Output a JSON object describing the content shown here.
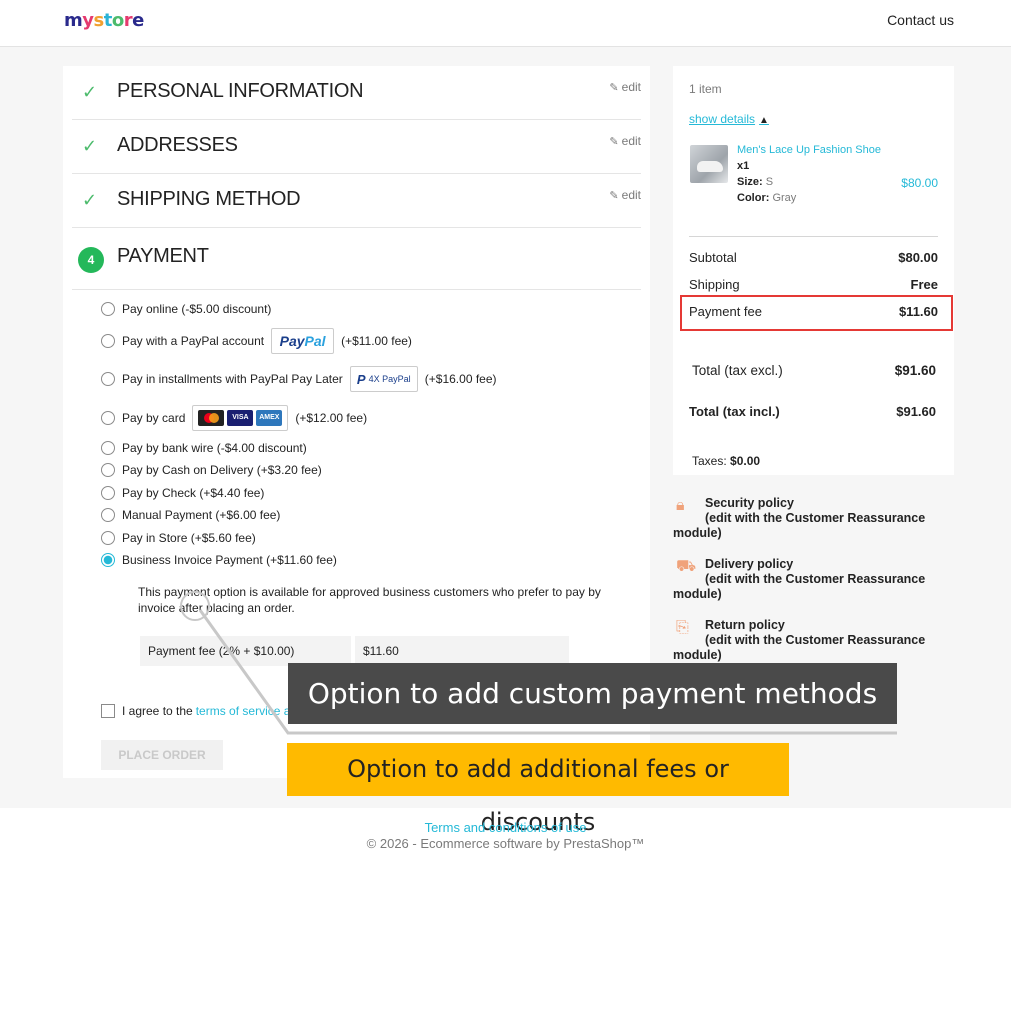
{
  "header": {
    "logo": {
      "parts": [
        "m",
        "y",
        " ",
        "s",
        "t",
        "o",
        "r",
        "e"
      ]
    },
    "contact": "Contact us"
  },
  "steps": [
    {
      "title": "PERSONAL INFORMATION",
      "edit": "edit",
      "status": "complete"
    },
    {
      "title": "ADDRESSES",
      "edit": "edit",
      "status": "complete"
    },
    {
      "title": "SHIPPING METHOD",
      "edit": "edit",
      "status": "complete"
    },
    {
      "title": "PAYMENT",
      "number": "4",
      "status": "current"
    }
  ],
  "payment": {
    "options": [
      {
        "label": "Pay online (-$5.00 discount)",
        "selected": false
      },
      {
        "label": "Pay with a PayPal account",
        "suffix": "(+$11.00 fee)",
        "logo": "paypal-logo",
        "selected": false
      },
      {
        "label": "Pay in installments with PayPal Pay Later",
        "suffix": "(+$16.00 fee)",
        "logo": "paypal-4x-logo",
        "logo_text": "4X PayPal",
        "selected": false
      },
      {
        "label": "Pay by card",
        "suffix": "(+$12.00 fee)",
        "logo": "card-logos",
        "selected": false
      },
      {
        "label": "Pay by bank wire (-$4.00 discount)",
        "selected": false
      },
      {
        "label": "Pay by Cash on Delivery (+$3.20 fee)",
        "selected": false
      },
      {
        "label": "Pay by Check (+$4.40 fee)",
        "selected": false
      },
      {
        "label": "Manual Payment (+$6.00 fee)",
        "selected": false
      },
      {
        "label": "Pay in Store (+$5.60 fee)",
        "selected": false
      },
      {
        "label": "Business Invoice Payment (+$11.60 fee)",
        "selected": true
      }
    ],
    "paypal_logo": {
      "p1": "Pay",
      "p2": "Pal"
    },
    "card_logos": [
      "",
      "VISA",
      "AMEX"
    ],
    "description": "This payment option is available for approved business customers who prefer to pay by invoice after placing an order.",
    "fee_label": "Payment fee (2% + $10.00)",
    "fee_value": "$11.60",
    "agree_prefix": "I agree to the ",
    "agree_link": "terms of service a",
    "place_order": "PLACE ORDER"
  },
  "summary": {
    "items_count": "1 item",
    "show_details": "show details",
    "product": {
      "name": "Men's Lace Up Fashion Shoe",
      "qty": "x1",
      "size_label": "Size:",
      "size_value": "S",
      "color_label": "Color:",
      "color_value": "Gray",
      "price": "$80.00"
    },
    "rows": [
      {
        "label": "Subtotal",
        "value": "$80.00"
      },
      {
        "label": "Shipping",
        "value": "Free"
      },
      {
        "label": "Payment fee",
        "value": "$11.60"
      },
      {
        "label": "Total (tax excl.)",
        "value": "$91.60"
      },
      {
        "label": "Total (tax incl.)",
        "value": "$91.60"
      }
    ],
    "taxes_label": "Taxes:",
    "taxes_value": "$0.00",
    "highlight_color": "#e53935"
  },
  "reassurance": [
    {
      "title": "Security policy",
      "sub": "(edit with the Customer Reassurance",
      "cont": "module)",
      "icon": "lock-icon"
    },
    {
      "title": "Delivery policy",
      "sub": "(edit with the Customer Reassurance",
      "cont": "module)",
      "icon": "truck-icon"
    },
    {
      "title": "Return policy",
      "sub": "(edit with the Customer Reassurance",
      "cont": "module)",
      "icon": "return-box-icon"
    }
  ],
  "callouts": {
    "custom_methods": "Option to add custom payment methods",
    "fees": "Option to add additional fees or discounts"
  },
  "footer": {
    "terms": "Terms and conditions of use",
    "copyright": "© 2026 - Ecommerce software by PrestaShop™"
  },
  "colors": {
    "accent": "#25b9d7",
    "success": "#24b85a",
    "callout_dark": "#4a4a4a",
    "callout_yellow": "#ffba00"
  }
}
